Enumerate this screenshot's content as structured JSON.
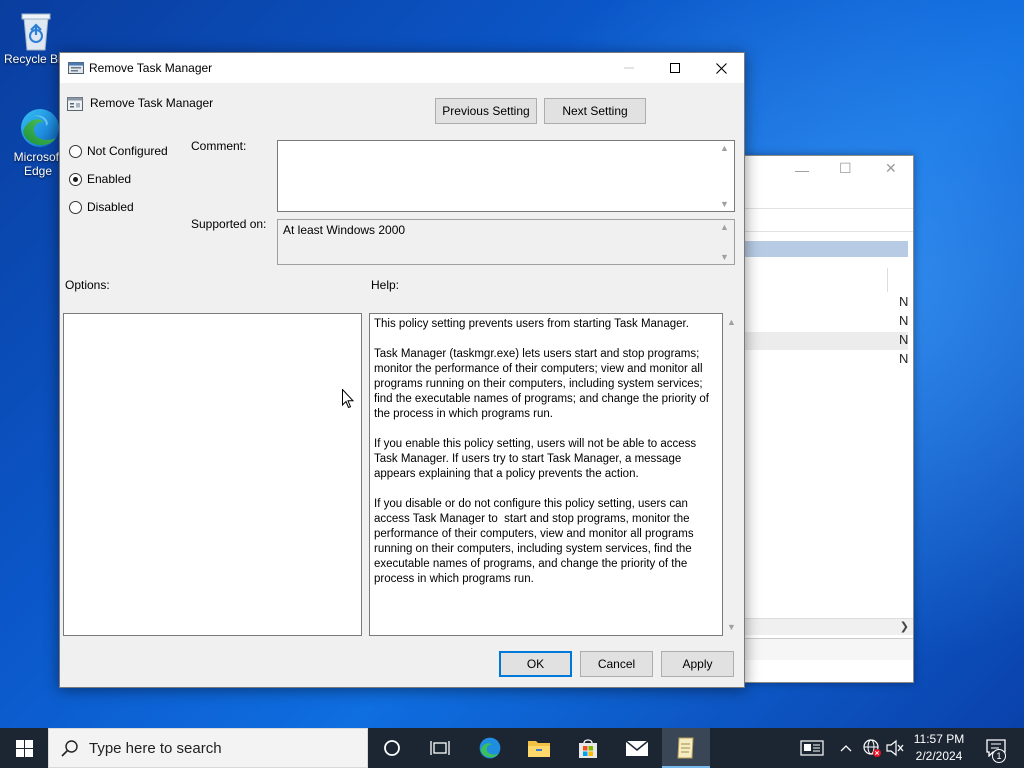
{
  "desktop": {
    "icons": [
      {
        "label": "Recycle Bin",
        "icon": "recycle-bin-icon"
      },
      {
        "label": "Microsoft Edge",
        "icon": "edge-icon"
      }
    ]
  },
  "background_window": {
    "rows": [
      "N",
      "N",
      "N",
      "N"
    ]
  },
  "dialog": {
    "title": "Remove Task Manager",
    "header_title": "Remove Task Manager",
    "previous_setting": "Previous Setting",
    "next_setting": "Next Setting",
    "radios": [
      {
        "label": "Not Configured",
        "checked": false
      },
      {
        "label": "Enabled",
        "checked": true
      },
      {
        "label": "Disabled",
        "checked": false
      }
    ],
    "comment_label": "Comment:",
    "comment_value": "",
    "supported_on_label": "Supported on:",
    "supported_on_value": "At least Windows 2000",
    "options_label": "Options:",
    "help_label": "Help:",
    "help_paragraphs": [
      "This policy setting prevents users from starting Task Manager.",
      "Task Manager (taskmgr.exe) lets users start and stop programs; monitor the performance of their computers; view and monitor all programs running on their computers, including system services; find the executable names of programs; and change the priority of the process in which programs run.",
      "If you enable this policy setting, users will not be able to access Task Manager. If users try to start Task Manager, a message appears explaining that a policy prevents the action.",
      "If you disable or do not configure this policy setting, users can access Task Manager to  start and stop programs, monitor the performance of their computers, view and monitor all programs running on their computers, including system services, find the executable names of programs, and change the priority of the process in which programs run."
    ],
    "ok": "OK",
    "cancel": "Cancel",
    "apply": "Apply"
  },
  "taskbar": {
    "search_placeholder": "Type here to search",
    "apps": [
      "task-view-icon",
      "edge-icon",
      "file-explorer-icon",
      "store-icon",
      "mail-icon",
      "notepad-icon"
    ],
    "clock_time": "11:57 PM",
    "clock_date": "2/2/2024",
    "notification_count": "1"
  },
  "colors": {
    "accent": "#0078d7",
    "taskbar": "#1c2633",
    "desktop": "#0b57c9"
  }
}
